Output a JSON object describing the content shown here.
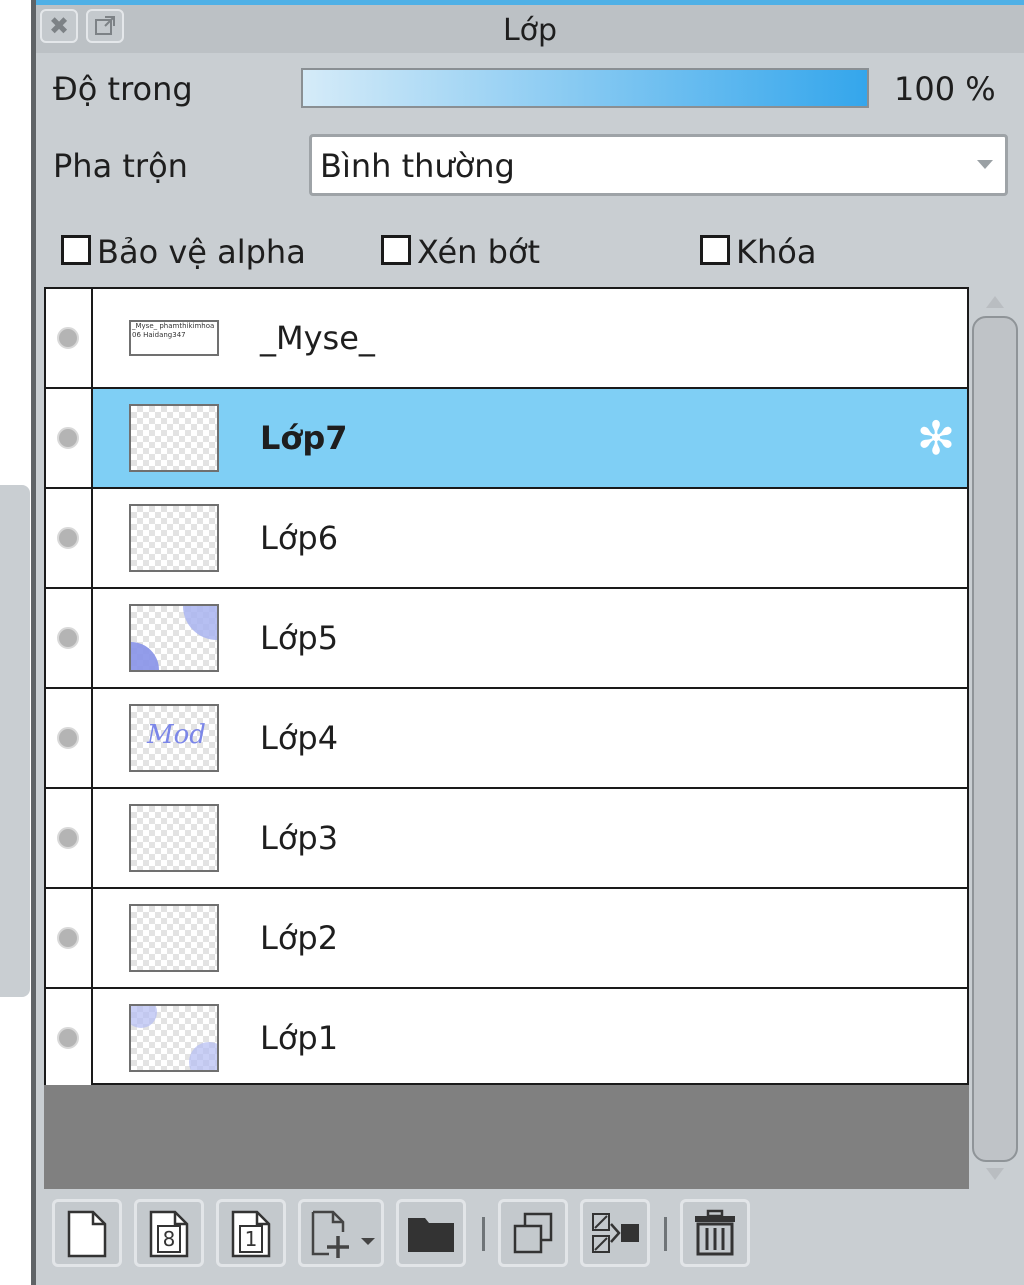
{
  "panel": {
    "title": "Lớp",
    "opacity_label": "Độ trong",
    "opacity_value_text": "100 %",
    "opacity_percent": 100,
    "blend_label": "Pha trộn",
    "blend_value": "Bình thường"
  },
  "options": {
    "protect_alpha": "Bảo vệ alpha",
    "clip": "Xén bớt",
    "lock": "Khóa"
  },
  "layers": [
    {
      "name": "_Myse_",
      "selected": false
    },
    {
      "name": "Lớp7",
      "selected": true
    },
    {
      "name": "Lớp6",
      "selected": false
    },
    {
      "name": "Lớp5",
      "selected": false
    },
    {
      "name": "Lớp4",
      "selected": false
    },
    {
      "name": "Lớp3",
      "selected": false
    },
    {
      "name": "Lớp2",
      "selected": false
    },
    {
      "name": "Lớp1",
      "selected": false
    }
  ],
  "thumb_texts": {
    "myse_thumb": "_Myse_ phamthikimhoa06 Haidang347",
    "lop4_thumb": "Mod"
  },
  "toolbar": {
    "add_8bit_icon_text": "8",
    "add_1bit_icon_text": "1"
  },
  "colors": {
    "accent": "#4fb0e6",
    "selected_row": "#7fcff5",
    "panel_bg": "#c9ced2"
  }
}
